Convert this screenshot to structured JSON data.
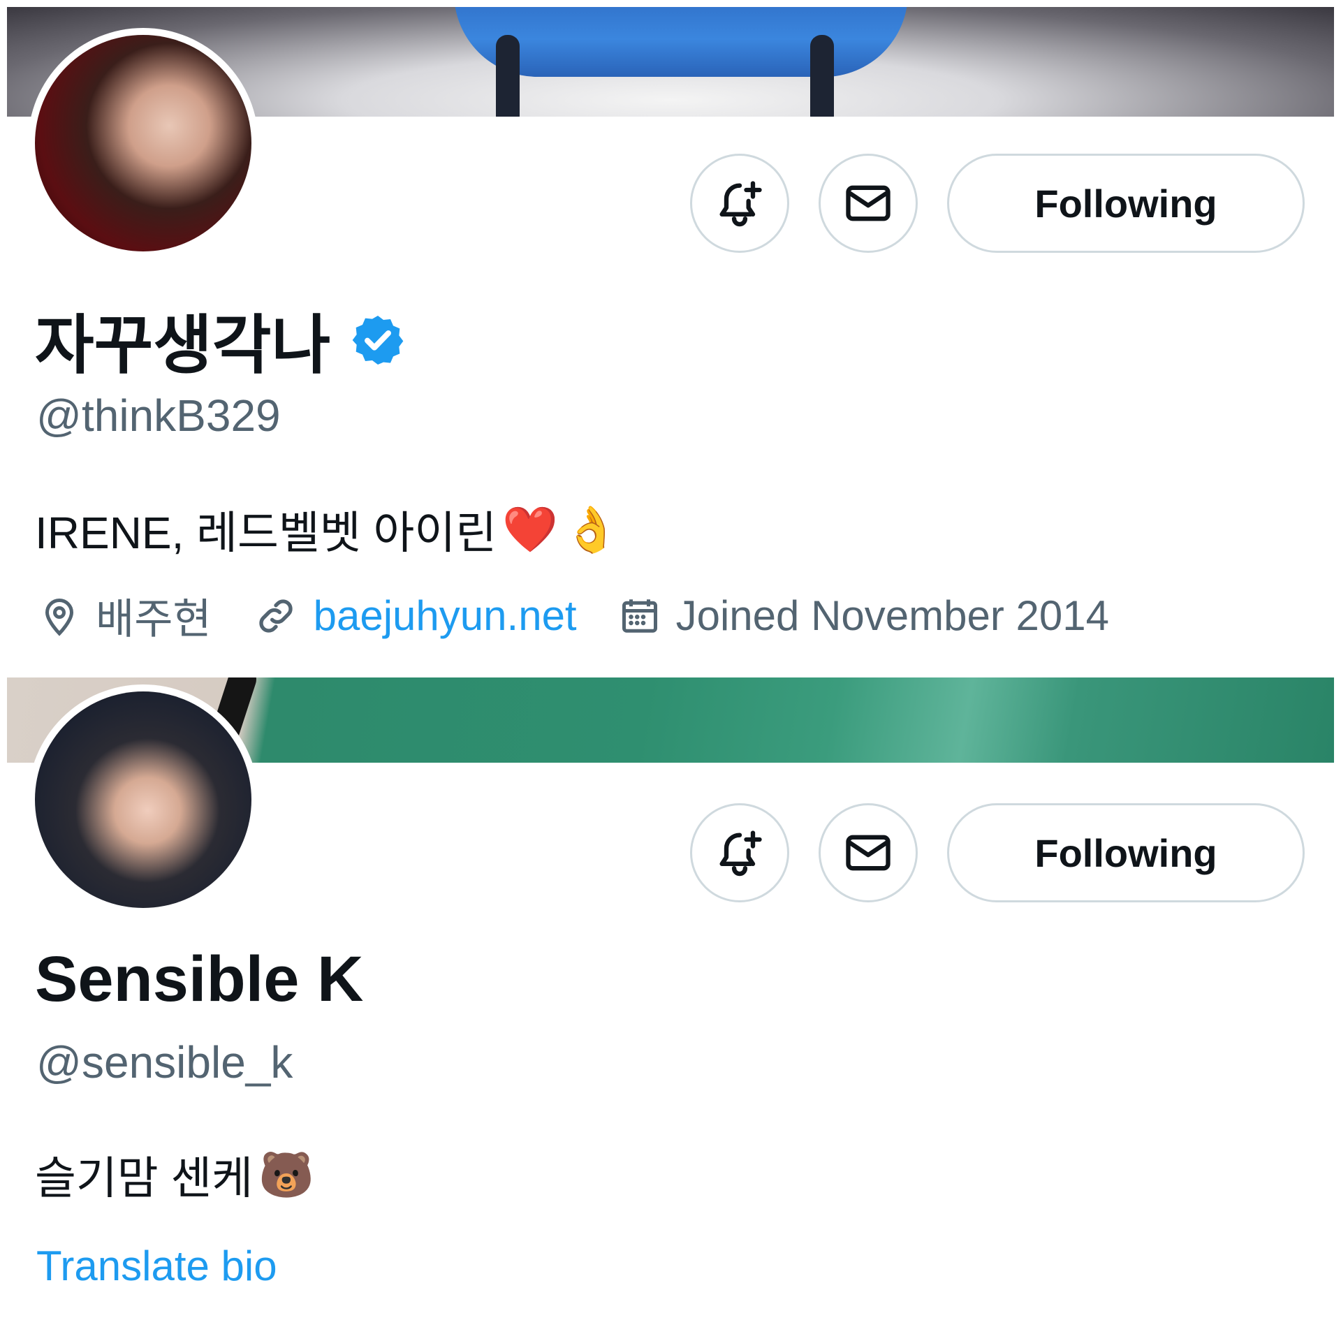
{
  "profiles": [
    {
      "display_name": "자꾸생각나",
      "verified": true,
      "handle": "@thinkB329",
      "bio": "IRENE, 레드벨벳 아이린",
      "bio_emojis": [
        "❤️",
        "👌"
      ],
      "location": "배주현",
      "website": "baejuhyun.net",
      "joined": "Joined November 2014",
      "follow_label": "Following",
      "banner_desc": "blue-bathtub-banner",
      "accent_color": "#1d9bf0"
    },
    {
      "display_name": "Sensible K",
      "verified": false,
      "handle": "@sensible_k",
      "bio": "슬기맘 센케",
      "bio_emojis": [
        "🐻"
      ],
      "translate_label": "Translate bio",
      "follow_label": "Following",
      "banner_desc": "green-abstract-banner",
      "accent_color": "#1d9bf0"
    }
  ],
  "icons": {
    "notify": "bell-plus-icon",
    "message": "envelope-icon",
    "verified": "verified-badge-icon",
    "location": "location-pin-icon",
    "link": "link-icon",
    "calendar": "calendar-icon"
  }
}
